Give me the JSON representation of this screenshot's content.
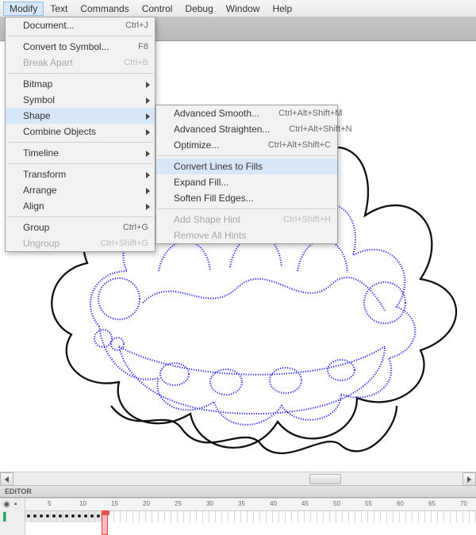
{
  "menubar": {
    "items": [
      "Modify",
      "Text",
      "Commands",
      "Control",
      "Debug",
      "Window",
      "Help"
    ],
    "open_index": 0
  },
  "modify_menu": {
    "items": [
      {
        "label": "Document...",
        "shortcut": "Ctrl+J"
      },
      {
        "sep": true
      },
      {
        "label": "Convert to Symbol...",
        "shortcut": "F8"
      },
      {
        "label": "Break Apart",
        "shortcut": "Ctrl+B",
        "disabled": true
      },
      {
        "sep": true
      },
      {
        "label": "Bitmap",
        "sub": true
      },
      {
        "label": "Symbol",
        "sub": true
      },
      {
        "label": "Shape",
        "sub": true,
        "highlight": true
      },
      {
        "label": "Combine Objects",
        "sub": true
      },
      {
        "sep": true
      },
      {
        "label": "Timeline",
        "sub": true
      },
      {
        "sep": true
      },
      {
        "label": "Transform",
        "sub": true
      },
      {
        "label": "Arrange",
        "sub": true
      },
      {
        "label": "Align",
        "sub": true
      },
      {
        "sep": true
      },
      {
        "label": "Group",
        "shortcut": "Ctrl+G"
      },
      {
        "label": "Ungroup",
        "shortcut": "Ctrl+Shift+G",
        "disabled": true
      }
    ]
  },
  "shape_submenu": {
    "items": [
      {
        "label": "Advanced Smooth...",
        "shortcut": "Ctrl+Alt+Shift+M"
      },
      {
        "label": "Advanced Straighten...",
        "shortcut": "Ctrl+Alt+Shift+N"
      },
      {
        "label": "Optimize...",
        "shortcut": "Ctrl+Alt+Shift+C"
      },
      {
        "sep": true
      },
      {
        "label": "Convert Lines to Fills",
        "highlight": true
      },
      {
        "label": "Expand Fill..."
      },
      {
        "label": "Soften Fill Edges..."
      },
      {
        "sep": true
      },
      {
        "label": "Add Shape Hint",
        "shortcut": "Ctrl+Shift+H",
        "disabled": true
      },
      {
        "label": "Remove All Hints",
        "disabled": true
      }
    ]
  },
  "editor_label": "EDITOR",
  "timeline": {
    "ruler_marks": [
      "5",
      "10",
      "15",
      "20",
      "25",
      "30",
      "35",
      "40",
      "45",
      "50",
      "55",
      "60",
      "65",
      "70"
    ],
    "keyframe_count": 12,
    "playhead_frame": 13
  }
}
